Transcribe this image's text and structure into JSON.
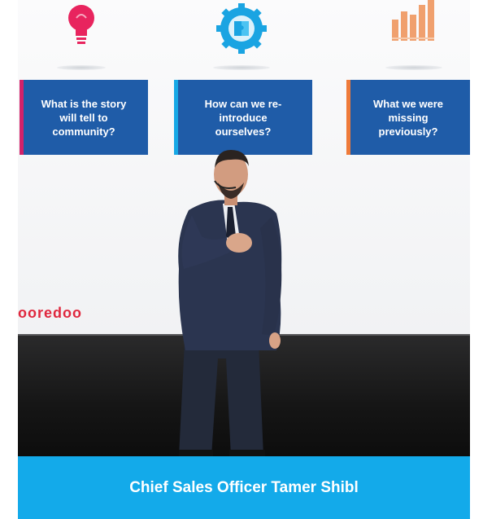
{
  "slide": {
    "questions": [
      {
        "text": "What is the story\nwill tell to\ncommunity?",
        "accent": "#d2226a"
      },
      {
        "text": "How can we re-\nintroduce\nourselves?",
        "accent": "#16a8e6"
      },
      {
        "text": "What we were\nmissing\npreviously?",
        "accent": "#ef7b3a"
      }
    ],
    "brand_logo": "ooredoo",
    "icons": [
      "lightbulb-icon",
      "puzzle-gear-icon",
      "bar-chart-icon"
    ]
  },
  "caption": {
    "text": "Chief Sales Officer Tamer Shibl",
    "background": "#13aaea"
  }
}
